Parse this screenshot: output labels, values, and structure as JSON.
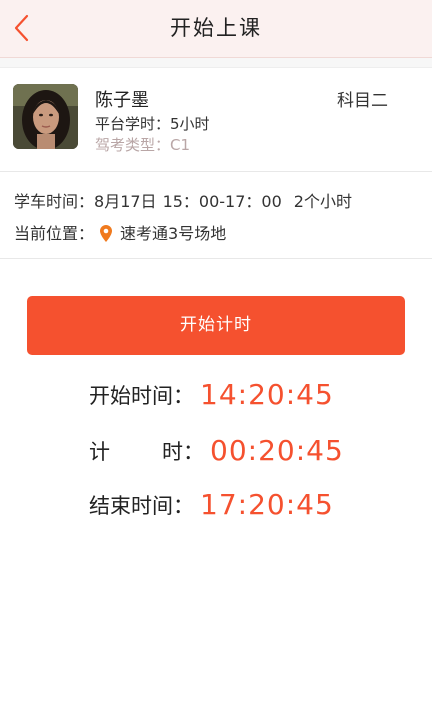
{
  "header": {
    "title": "开始上课"
  },
  "icons": {
    "back": "chevron-left-icon",
    "location": "location-pin-icon",
    "accent": "#f5512f"
  },
  "student": {
    "name": "陈子墨",
    "subject": "科目二",
    "platform_hours": "平台学时：5小时",
    "license_type": "驾考类型：C1"
  },
  "booking": {
    "time_label": "学车时间：",
    "date": "8月17日",
    "time_range": "15：00-17：00",
    "duration": "2个小时",
    "location_label": "当前位置：",
    "location": "速考通3号场地"
  },
  "action": {
    "start_label": "开始计时"
  },
  "timer": {
    "start_label": "开始时间：",
    "start_value": "14:20:45",
    "elapsed_label_a": "计",
    "elapsed_label_b": "时：",
    "elapsed_value": "00:20:45",
    "end_label": "结束时间：",
    "end_value": "17:20:45"
  }
}
